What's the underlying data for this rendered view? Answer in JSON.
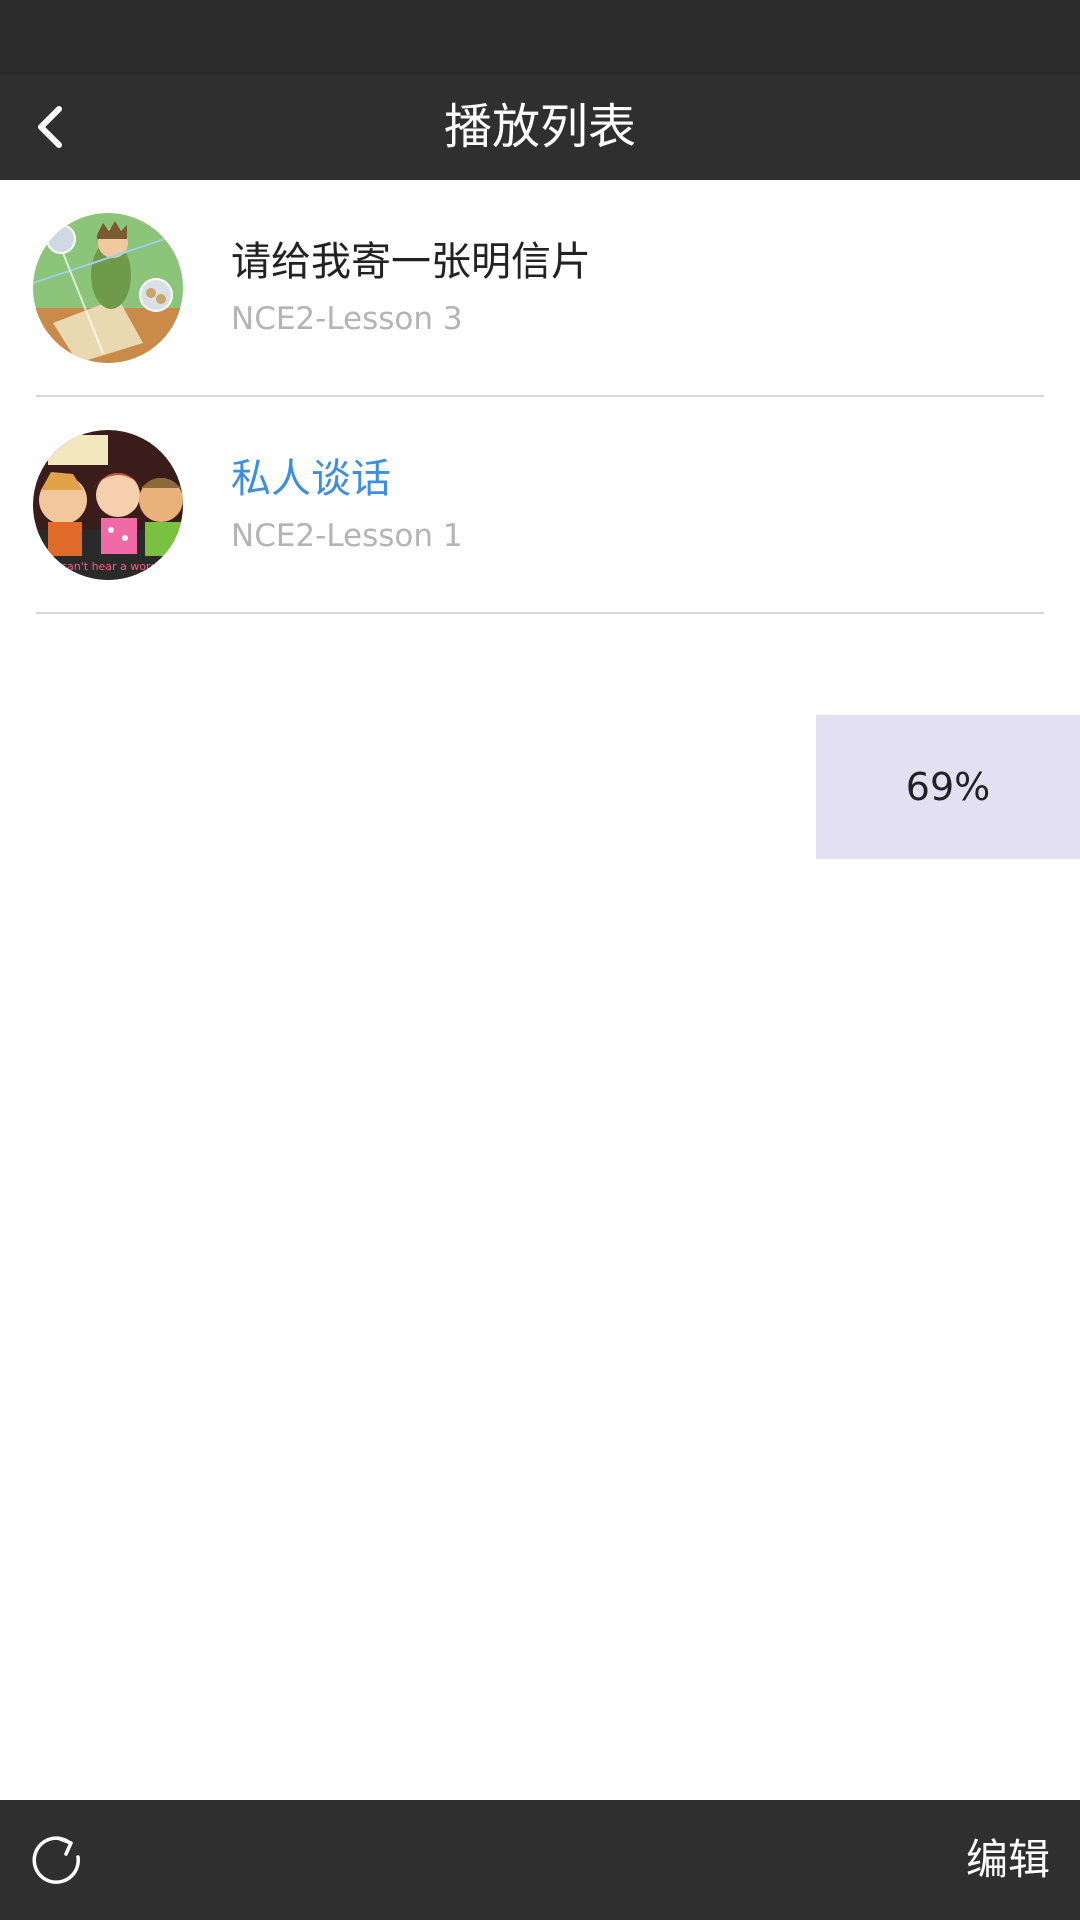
{
  "app": {
    "title": "播放列表"
  },
  "nav": {
    "back_icon": "chevron-left-icon"
  },
  "playlist": [
    {
      "title": "请给我寄一张明信片",
      "subtitle": "NCE2-Lesson 3",
      "active": false,
      "thumbnail_icon": "lesson3-cartoon-thumbnail"
    },
    {
      "title": "私人谈话",
      "subtitle": "NCE2-Lesson 1",
      "active": true,
      "thumbnail_icon": "lesson1-cartoon-thumbnail",
      "thumbnail_caption": "I can't hear a word!"
    }
  ],
  "progress": {
    "label": "69%",
    "value": 69
  },
  "toolbar": {
    "refresh_icon": "refresh-icon",
    "edit_label": "编辑"
  },
  "colors": {
    "header_bg": "#2f2f2f",
    "status_bg": "#2b2b2b",
    "accent_active": "#3d8ee0",
    "subtitle_gray": "#b4b4b4",
    "badge_bg": "#e2e0f2"
  }
}
